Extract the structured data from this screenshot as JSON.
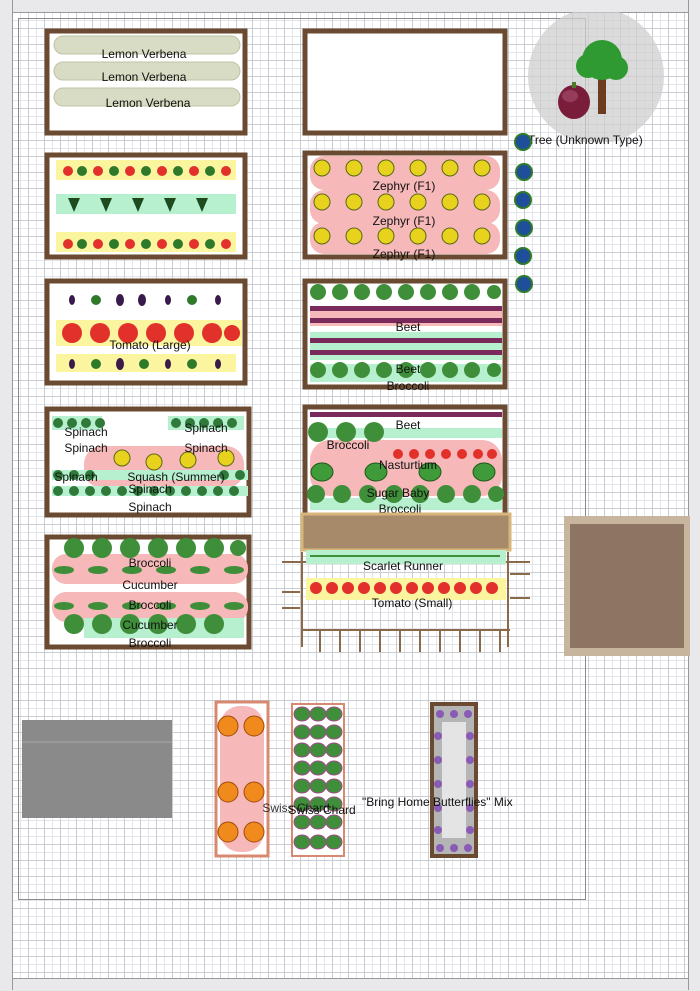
{
  "labels": {
    "lemon_1": "Lemon Verbena",
    "lemon_2": "Lemon Verbena",
    "lemon_3": "Lemon Verbena",
    "zephyr_1": "Zephyr (F1)",
    "zephyr_2": "Zephyr (F1)",
    "zephyr_3": "Zephyr (F1)",
    "tree": "Tree (Unknown Type)",
    "tomato_large": "Tomato (Large)",
    "beet_1": "Beet",
    "beet_2": "Beet",
    "broccoli_b4": "Broccoli",
    "spinach_1": "Spinach",
    "spinach_2": "Spinach",
    "spinach_3": "Spinach",
    "spinach_4": "Spinach",
    "spinach_5": "Spinach",
    "spinach_6": "Spinach",
    "spinach_7": "Spinach",
    "squash": "Squash (Summer)",
    "beet_3": "Beet",
    "broccoli_b5a": "Broccoli",
    "nasturtium": "Nasturtium",
    "sugar_baby": "Sugar Baby",
    "broccoli_b5b": "Broccoli",
    "broccoli_b6a": "Broccoli",
    "cucumber_1": "Cucumber",
    "broccoli_b6b": "Broccoli",
    "cucumber_2": "Cucumber",
    "broccoli_b6c": "Broccoli",
    "scarlet_runner": "Scarlet Runner",
    "tomato_small": "Tomato (Small)",
    "swiss_chard_1": "Swiss Chard",
    "swiss_chard_2": "Swiss Chard",
    "butterflies": "\"Bring Home Butterflies\" Mix"
  },
  "colors": {
    "frame": "#6b4a32",
    "pink_zone": "#f6b8b8",
    "yellow_zone": "#fbf5a0",
    "green_zone": "#b7f0cf",
    "broccoli": "#3f8f3a",
    "tomato": "#e2302a",
    "squash": "#e8d21e",
    "beet": "#7a2a5a",
    "pumpkin": "#f08a1c",
    "lavender": "#8a5bb5",
    "blueberry": "#1f4f9a",
    "gravel": "#8a8a8a",
    "planter": "#8e7563"
  },
  "icons": [
    "lemon-verbena-icon",
    "tomato-icon",
    "eggplant-icon",
    "pepper-icon",
    "zephyr-squash-icon",
    "broccoli-icon",
    "beet-icon",
    "spinach-icon",
    "cucumber-icon",
    "watermelon-icon",
    "nasturtium-icon",
    "bean-icon",
    "pumpkin-icon",
    "swiss-chard-icon",
    "lavender-icon",
    "blueberry-icon",
    "tree-icon",
    "fig-icon"
  ]
}
